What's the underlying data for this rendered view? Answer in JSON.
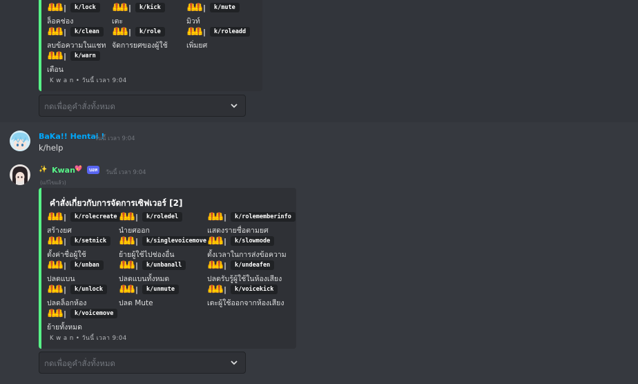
{
  "embed1": {
    "commands": [
      {
        "code": "k/lock",
        "desc": "ล็อคช่อง"
      },
      {
        "code": "k/kick",
        "desc": "เตะ"
      },
      {
        "code": "k/mute",
        "desc": "มิวท์"
      },
      {
        "code": "k/clean",
        "desc": "ลบข้อความในแชท"
      },
      {
        "code": "k/role",
        "desc": "จัดการยศของผู้ใช้"
      },
      {
        "code": "k/roleadd",
        "desc": "เพิ่มยศ"
      },
      {
        "code": "k/warn",
        "desc": "เตือน"
      }
    ],
    "footer": "K w a n • วันนี้ เวลา 9:04"
  },
  "select1": {
    "placeholder": "กดเพื่อดูคำสั่งทั้งหมด"
  },
  "msg_baka": {
    "username": "BaKa!! Hentai !",
    "timestamp": "วันนี้ เวลา 9:04",
    "text": "k/help"
  },
  "msg_kwan": {
    "sparkle": "✨",
    "username": "Kwan",
    "heart": "💖",
    "badge": "บอท",
    "timestamp": "วันนี้ เวลา 9:04",
    "edited": "(แก้ไขแล้ว)"
  },
  "embed2": {
    "title": "คำสั่งเกี่ยวกับการจัดการเซิฟเวอร์ [2]",
    "commands": [
      {
        "code": "k/rolecreate",
        "desc": "สร้างยศ"
      },
      {
        "code": "k/roledel",
        "desc": "นำยศออก"
      },
      {
        "code": "k/rolememberinfo",
        "desc": "แสดงรายชื่อตามยศ"
      },
      {
        "code": "k/setnick",
        "desc": "ตั้งค่าชื่อผู้ใช้"
      },
      {
        "code": "k/singlevoicemove",
        "desc": "ย้ายผู้ใช้ไปช่องอื่น"
      },
      {
        "code": "k/slowmode",
        "desc": "ตั้งเวลาในการส่งข้อความ"
      },
      {
        "code": "k/unban",
        "desc": "ปลดแบน"
      },
      {
        "code": "k/unbanall",
        "desc": "ปลดแบนทั้งหมด"
      },
      {
        "code": "k/undeafen",
        "desc": "ปลดรับรู้ผู้ใช้ในห้องเสียง"
      },
      {
        "code": "k/unlock",
        "desc": "ปลดล็อกห้อง"
      },
      {
        "code": "k/unmute",
        "desc": "ปลด Mute"
      },
      {
        "code": "k/voicekick",
        "desc": "เตะผู้ใช้ออกจากห้องเสียง"
      },
      {
        "code": "k/voicemove",
        "desc": "ย้ายทั้งหมด"
      }
    ],
    "footer": "K w a n • วันนี้ เวลา 9:04"
  },
  "select2": {
    "placeholder": "กดเพื่อดูคำสั่งทั้งหมด"
  },
  "icons": {
    "cone": "🦺🦺",
    "bar": "|"
  },
  "colors": {
    "background": "#36393f",
    "embed_bg": "#2f3136",
    "embed_border": "#57f287",
    "baka_name": "#00a8fc",
    "kwan_name": "#57f287",
    "bot_badge": "#5865f2"
  }
}
